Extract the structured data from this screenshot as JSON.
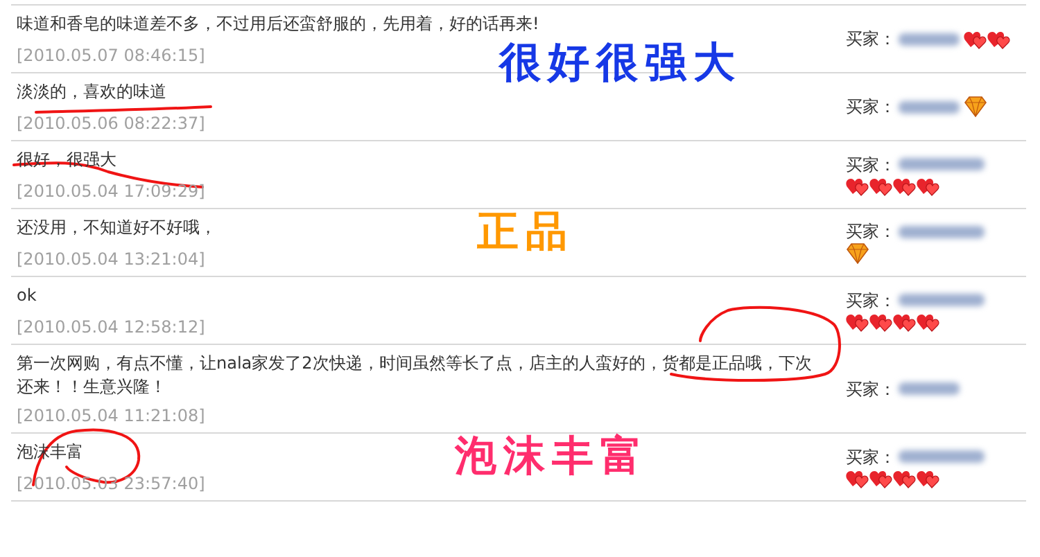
{
  "reviews": [
    {
      "comment": "味道和香皂的味道差不多，不过用后还蛮舒服的，先用着，好的话再来!",
      "date": "[2010.05.07 08:46:15]",
      "buyer_label": "买家：",
      "rank_icons": [
        {
          "kind": "heart"
        },
        {
          "kind": "heart"
        }
      ],
      "overlay": {
        "text": "很好很强大",
        "color": "#1638e6",
        "kind": "top"
      }
    },
    {
      "comment": "淡淡的，喜欢的味道",
      "date": "[2010.05.06 08:22:37]",
      "buyer_label": "买家：",
      "rank_icons": [
        {
          "kind": "diamond"
        }
      ],
      "pen_mark": {
        "kind": "underline"
      }
    },
    {
      "comment": "很好，很强大",
      "date": "[2010.05.04 17:09:29]",
      "buyer_label": "买家：",
      "rank_icons": [
        {
          "kind": "heart"
        },
        {
          "kind": "heart"
        },
        {
          "kind": "heart"
        },
        {
          "kind": "heart"
        }
      ],
      "pen_mark": {
        "kind": "slash"
      }
    },
    {
      "comment": "还没用，不知道好不好哦，",
      "date": "[2010.05.04 13:21:04]",
      "buyer_label": "买家：",
      "rank_icons": [
        {
          "kind": "diamond"
        }
      ],
      "overlay": {
        "text": "正品",
        "color": "#ff9800",
        "kind": "mid"
      }
    },
    {
      "comment": "ok",
      "date": "[2010.05.04 12:58:12]",
      "buyer_label": "买家：",
      "rank_icons": [
        {
          "kind": "heart"
        },
        {
          "kind": "heart"
        },
        {
          "kind": "heart"
        },
        {
          "kind": "heart"
        }
      ]
    },
    {
      "comment": "第一次网购，有点不懂，让nala家发了2次快递，时间虽然等长了点，店主的人蛮好的，货都是正品哦，下次还来！！生意兴隆！",
      "date": "[2010.05.04 11:21:08]",
      "buyer_label": "买家：",
      "pen_mark": {
        "kind": "oval"
      }
    },
    {
      "comment": "泡沫丰富",
      "date": "[2010.05.03 23:57:40]",
      "buyer_label": "买家：",
      "rank_icons": [
        {
          "kind": "heart"
        },
        {
          "kind": "heart"
        },
        {
          "kind": "heart"
        },
        {
          "kind": "heart"
        }
      ],
      "overlay": {
        "text": "泡沫丰富",
        "color": "#ff2d6d",
        "kind": "mid"
      },
      "pen_mark": {
        "kind": "circle"
      }
    }
  ]
}
